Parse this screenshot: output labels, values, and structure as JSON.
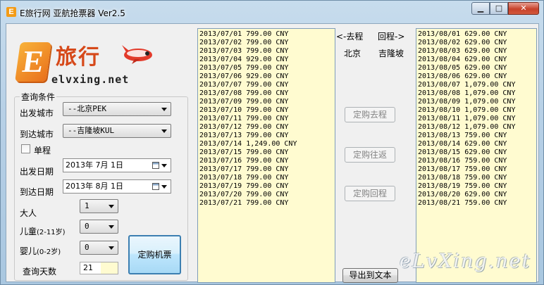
{
  "window": {
    "title": "E旅行网 亚航抢票器 Ver2.5",
    "app_icon_label": "E",
    "minimize": "▁",
    "maximize": "□",
    "close": "✕"
  },
  "logo": {
    "cn_text": "旅行",
    "url_text": "elvxing.net",
    "e_letter": "E"
  },
  "form": {
    "group_title": "查询条件",
    "from_label": "出发城市",
    "from_value": "--北京PEK",
    "to_label": "到达城市",
    "to_value": "--吉隆坡KUL",
    "oneway_label": "单程",
    "depart_label": "出发日期",
    "depart_value": "2013年  7月  1日",
    "arrive_label": "到达日期",
    "arrive_value": "2013年  8月  1日",
    "adult_label": "大人",
    "adult_value": "1",
    "child_label": "儿童",
    "child_age": "(2-11岁)",
    "child_value": "0",
    "infant_label": "婴儿",
    "infant_age": "(0-2岁)",
    "infant_value": "0",
    "days_label": "查询天数",
    "days_value": "21",
    "book_button": "定购机票"
  },
  "middle": {
    "outbound_label": "<-去程",
    "return_label": "回程->",
    "from_city": "北京",
    "to_city": "吉隆坡",
    "book_outbound": "定购去程",
    "book_roundtrip": "定购往返",
    "book_return": "定购回程",
    "export_button": "导出到文本"
  },
  "outbound_list": [
    "2013/07/01 799.00 CNY",
    "2013/07/02 799.00 CNY",
    "2013/07/03 799.00 CNY",
    "2013/07/04 929.00 CNY",
    "2013/07/05 799.00 CNY",
    "2013/07/06 929.00 CNY",
    "2013/07/07 799.00 CNY",
    "2013/07/08 799.00 CNY",
    "2013/07/09 799.00 CNY",
    "2013/07/10 799.00 CNY",
    "2013/07/11 799.00 CNY",
    "2013/07/12 799.00 CNY",
    "2013/07/13 799.00 CNY",
    "2013/07/14 1,249.00 CNY",
    "2013/07/15 799.00 CNY",
    "2013/07/16 799.00 CNY",
    "2013/07/17 799.00 CNY",
    "2013/07/18 799.00 CNY",
    "2013/07/19 799.00 CNY",
    "2013/07/20 799.00 CNY",
    "2013/07/21 799.00 CNY"
  ],
  "return_list": [
    "2013/08/01 629.00 CNY",
    "2013/08/02 629.00 CNY",
    "2013/08/03 629.00 CNY",
    "2013/08/04 629.00 CNY",
    "2013/08/05 629.00 CNY",
    "2013/08/06 629.00 CNY",
    "2013/08/07 1,079.00 CNY",
    "2013/08/08 1,079.00 CNY",
    "2013/08/09 1,079.00 CNY",
    "2013/08/10 1,079.00 CNY",
    "2013/08/11 1,079.00 CNY",
    "2013/08/12 1,079.00 CNY",
    "2013/08/13 759.00 CNY",
    "2013/08/14 629.00 CNY",
    "2013/08/15 629.00 CNY",
    "2013/08/16 759.00 CNY",
    "2013/08/17 759.00 CNY",
    "2013/08/18 759.00 CNY",
    "2013/08/19 759.00 CNY",
    "2013/08/20 629.00 CNY",
    "2013/08/21 759.00 CNY"
  ],
  "watermark": "eLvXing.net",
  "colors": {
    "list_bg": "#fffbd0",
    "accent_orange": "#e9701b",
    "logo_red": "#d6491a"
  }
}
